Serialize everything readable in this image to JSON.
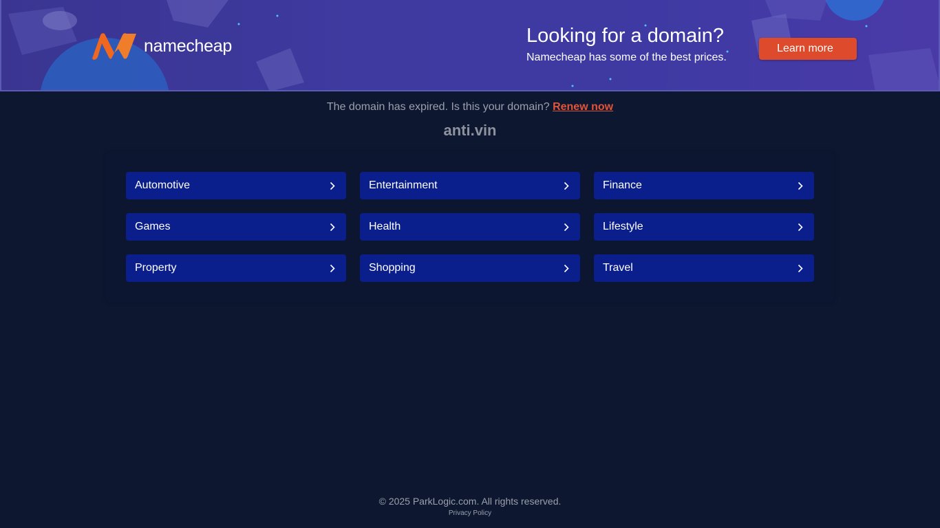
{
  "banner": {
    "brand_name": "namecheap",
    "title": "Looking for a domain?",
    "subtitle": "Namecheap has some of the best prices.",
    "cta_label": "Learn more",
    "colors": {
      "cta": "#dd4a2c",
      "logo": "#f0671f",
      "background": "#3e3aa0"
    }
  },
  "notice": {
    "text": "The domain has expired. Is this your domain? ",
    "link_label": "Renew now"
  },
  "domain_name": "anti.vin",
  "categories": [
    {
      "label": "Automotive",
      "icon": "chevron-right-icon"
    },
    {
      "label": "Entertainment",
      "icon": "chevron-right-icon"
    },
    {
      "label": "Finance",
      "icon": "chevron-right-icon"
    },
    {
      "label": "Games",
      "icon": "chevron-right-icon"
    },
    {
      "label": "Health",
      "icon": "chevron-right-icon"
    },
    {
      "label": "Lifestyle",
      "icon": "chevron-right-icon"
    },
    {
      "label": "Property",
      "icon": "chevron-right-icon"
    },
    {
      "label": "Shopping",
      "icon": "chevron-right-icon"
    },
    {
      "label": "Travel",
      "icon": "chevron-right-icon"
    }
  ],
  "footer": {
    "copyright": "© 2025 ParkLogic.com. All rights reserved.",
    "privacy_label": "Privacy Policy"
  }
}
